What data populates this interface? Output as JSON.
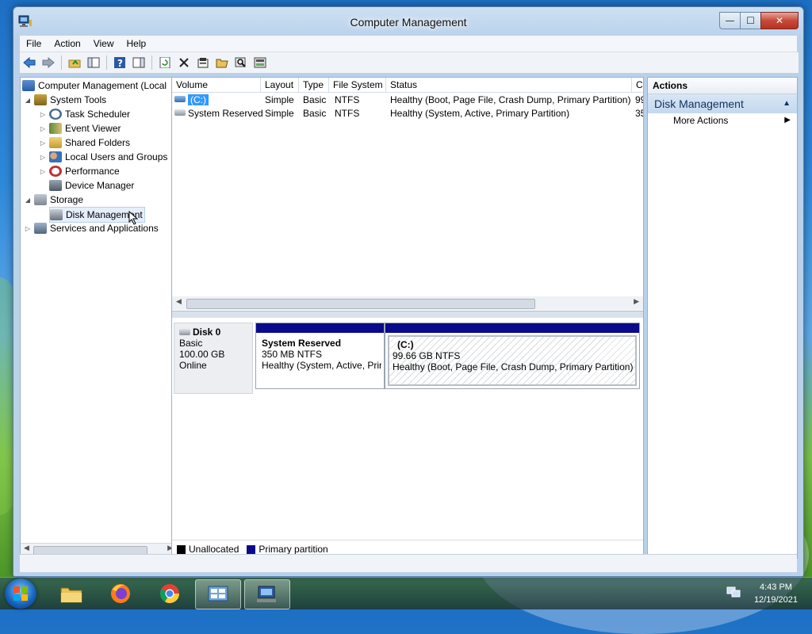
{
  "window": {
    "title": "Computer Management",
    "controls": {
      "minimize": "—",
      "maximize": "☐",
      "close": "✕"
    }
  },
  "menu": [
    "File",
    "Action",
    "View",
    "Help"
  ],
  "tree": {
    "root": "Computer Management (Local",
    "items": [
      {
        "label": "System Tools",
        "level": 1
      },
      {
        "label": "Task Scheduler",
        "level": 2
      },
      {
        "label": "Event Viewer",
        "level": 2
      },
      {
        "label": "Shared Folders",
        "level": 2
      },
      {
        "label": "Local Users and Groups",
        "level": 2
      },
      {
        "label": "Performance",
        "level": 2
      },
      {
        "label": "Device Manager",
        "level": 2
      },
      {
        "label": "Storage",
        "level": 1
      },
      {
        "label": "Disk Management",
        "level": 2,
        "selected": true
      },
      {
        "label": "Services and Applications",
        "level": 1
      }
    ]
  },
  "volumes": {
    "columns": [
      "Volume",
      "Layout",
      "Type",
      "File System",
      "Status",
      "C"
    ],
    "rows": [
      {
        "volume": "(C:)",
        "layout": "Simple",
        "type": "Basic",
        "fs": "NTFS",
        "status": "Healthy (Boot, Page File, Crash Dump, Primary Partition)",
        "cap": "99"
      },
      {
        "volume": "System Reserved",
        "layout": "Simple",
        "type": "Basic",
        "fs": "NTFS",
        "status": "Healthy (System, Active, Primary Partition)",
        "cap": "35"
      }
    ]
  },
  "disk": {
    "name": "Disk 0",
    "type": "Basic",
    "size": "100.00 GB",
    "state": "Online",
    "partitions": [
      {
        "title": "System Reserved",
        "size": "350 MB NTFS",
        "status": "Healthy (System, Active, Prir"
      },
      {
        "title": "(C:)",
        "size": "99.66 GB NTFS",
        "status": "Healthy (Boot, Page File, Crash Dump, Primary Partition)"
      }
    ]
  },
  "legend": {
    "unallocated": "Unallocated",
    "primary": "Primary partition",
    "unallocated_color": "#000000",
    "primary_color": "#0a0a8c"
  },
  "actions": {
    "header": "Actions",
    "section": "Disk Management",
    "more": "More Actions"
  },
  "taskbar": {
    "time": "4:43 PM",
    "date": "12/19/2021"
  }
}
